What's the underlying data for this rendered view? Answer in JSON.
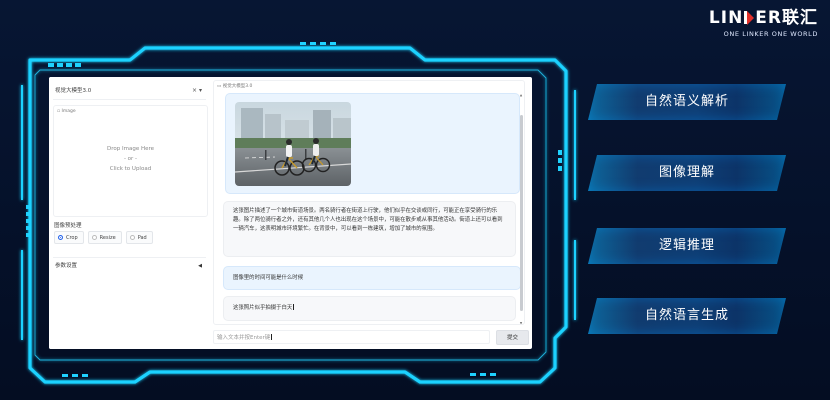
{
  "brand": {
    "logo_a": "LIN",
    "logo_b": "ER联汇",
    "tagline": "ONE LINKER  ONE WORLD"
  },
  "left_panel": {
    "model_select": {
      "value": "视觉大模型3.0",
      "controls": "× ▾"
    },
    "image_block": {
      "label": "Image",
      "drop_line1": "Drop Image Here",
      "drop_line2": "- or -",
      "drop_line3": "Click to Upload"
    },
    "resize_label": "图像预处理",
    "resize_options": [
      {
        "label": "Crop",
        "checked": true
      },
      {
        "label": "Resize",
        "checked": false
      },
      {
        "label": "Pad",
        "checked": false
      }
    ],
    "params_label": "参数设置",
    "params_arrow": "◀"
  },
  "chat": {
    "label": "视觉大模型3.0",
    "messages": [
      {
        "role": "user",
        "type": "image"
      },
      {
        "role": "bot",
        "text": "这张图片描述了一个城市街道场景。两名骑行者在街道上行驶，他们似乎在交谈或同行，可能正在享受骑行的乐趣。除了两位骑行者之外，还有其他几个人也出现在这个场景中，可能在散步或从事其他活动。街道上还可以看到一辆汽车，这表明城市环境繁忙。在背景中，可以看到一栋建筑，增加了城市的氛围。"
      },
      {
        "role": "user",
        "text": "图像里的时间可能是什么时候"
      },
      {
        "role": "bot",
        "text": "这张照片似乎拍摄于白天"
      }
    ],
    "scroll_up": "▲",
    "scroll_down": "▼"
  },
  "input": {
    "placeholder": "输入文本并按Enter键"
  },
  "submit_label": "提交",
  "features": [
    "自然语义解析",
    "图像理解",
    "逻辑推理",
    "自然语言生成"
  ],
  "colors": {
    "background": "#06122a",
    "frame_cyan": "#1fd2ff",
    "accent_blue": "#2563eb",
    "brand_red": "#e0302a"
  }
}
